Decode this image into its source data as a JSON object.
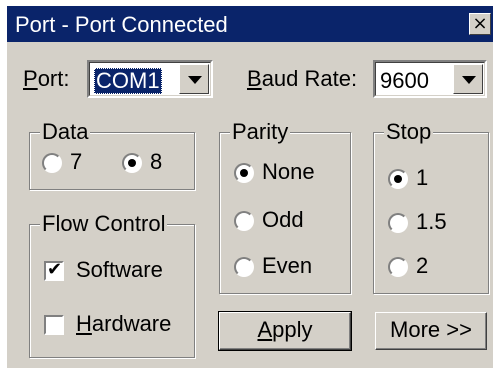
{
  "window": {
    "title": "Port - Port Connected",
    "close_glyph": "×"
  },
  "port": {
    "label_u": "P",
    "label_rest": "ort:",
    "value": "COM1"
  },
  "baud": {
    "label_u": "B",
    "label_rest": "aud Rate:",
    "value": "9600"
  },
  "data_group": {
    "legend": "Data",
    "options": [
      "7",
      "8"
    ],
    "selected": "8"
  },
  "parity_group": {
    "legend": "Parity",
    "options": [
      "None",
      "Odd",
      "Even"
    ],
    "selected": "None"
  },
  "stop_group": {
    "legend": "Stop",
    "options": [
      "1",
      "1.5",
      "2"
    ],
    "selected": "1"
  },
  "flow_group": {
    "legend": "Flow Control",
    "software": {
      "label": "Software",
      "checked": true
    },
    "hardware": {
      "label_u": "H",
      "label_rest": "ardware",
      "checked": false
    }
  },
  "buttons": {
    "apply_u": "A",
    "apply_rest": "pply",
    "more": "More >>"
  },
  "icons": {
    "check": "✔"
  },
  "colors": {
    "titlebar": "#0a246a",
    "face": "#d4d0c8"
  }
}
